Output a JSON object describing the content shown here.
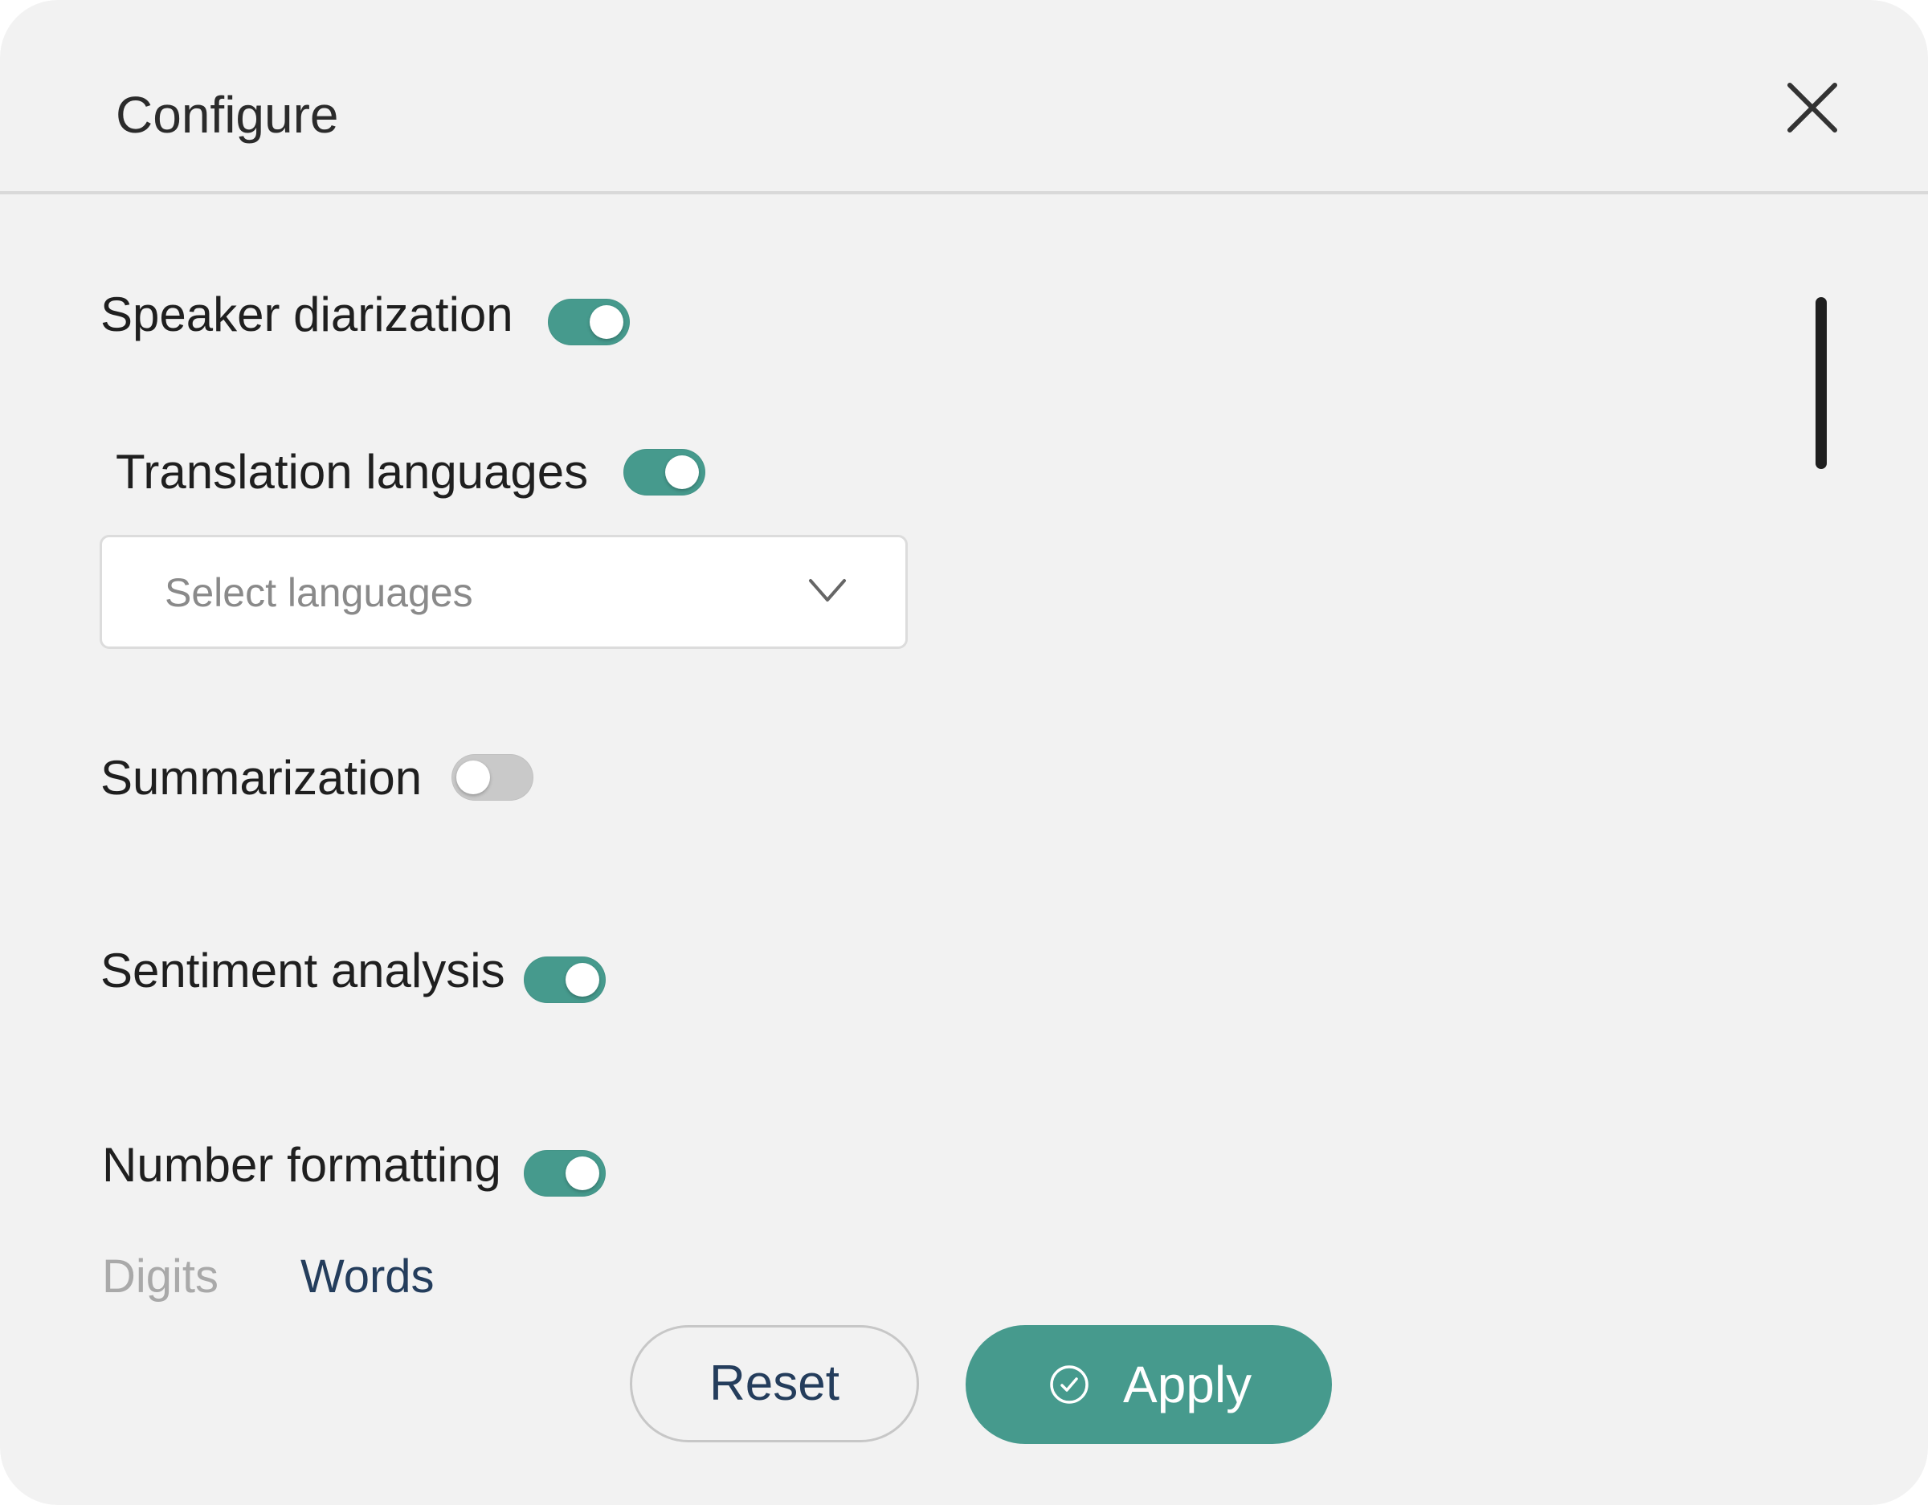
{
  "dialog": {
    "title": "Configure",
    "close_icon": "close-icon"
  },
  "settings": {
    "speaker_diarization": {
      "label": "Speaker diarization",
      "enabled": true
    },
    "translation_languages": {
      "label": "Translation languages",
      "enabled": true,
      "select_placeholder": "Select languages",
      "chevron_icon": "chevron-down-icon"
    },
    "summarization": {
      "label": "Summarization",
      "enabled": false
    },
    "sentiment_analysis": {
      "label": "Sentiment analysis",
      "enabled": true
    },
    "number_formatting": {
      "label": "Number formatting",
      "enabled": true,
      "options": [
        "Digits",
        "Words"
      ],
      "selected": "Words"
    }
  },
  "footer": {
    "reset_label": "Reset",
    "apply_label": "Apply",
    "apply_icon": "check-circle-icon"
  },
  "colors": {
    "accent": "#469a8d",
    "toggle_off": "#c9c9c9",
    "background": "#f2f2f2",
    "text_dark": "#1f1f1f",
    "text_navy": "#243d5c",
    "text_muted": "#a9a9a9"
  }
}
